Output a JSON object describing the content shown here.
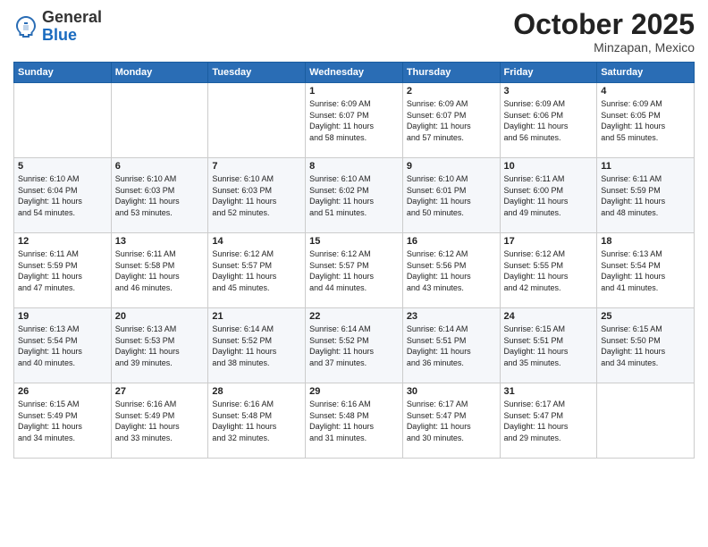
{
  "header": {
    "logo_general": "General",
    "logo_blue": "Blue",
    "month": "October 2025",
    "location": "Minzapan, Mexico"
  },
  "weekdays": [
    "Sunday",
    "Monday",
    "Tuesday",
    "Wednesday",
    "Thursday",
    "Friday",
    "Saturday"
  ],
  "weeks": [
    [
      {
        "day": "",
        "info": ""
      },
      {
        "day": "",
        "info": ""
      },
      {
        "day": "",
        "info": ""
      },
      {
        "day": "1",
        "info": "Sunrise: 6:09 AM\nSunset: 6:07 PM\nDaylight: 11 hours\nand 58 minutes."
      },
      {
        "day": "2",
        "info": "Sunrise: 6:09 AM\nSunset: 6:07 PM\nDaylight: 11 hours\nand 57 minutes."
      },
      {
        "day": "3",
        "info": "Sunrise: 6:09 AM\nSunset: 6:06 PM\nDaylight: 11 hours\nand 56 minutes."
      },
      {
        "day": "4",
        "info": "Sunrise: 6:09 AM\nSunset: 6:05 PM\nDaylight: 11 hours\nand 55 minutes."
      }
    ],
    [
      {
        "day": "5",
        "info": "Sunrise: 6:10 AM\nSunset: 6:04 PM\nDaylight: 11 hours\nand 54 minutes."
      },
      {
        "day": "6",
        "info": "Sunrise: 6:10 AM\nSunset: 6:03 PM\nDaylight: 11 hours\nand 53 minutes."
      },
      {
        "day": "7",
        "info": "Sunrise: 6:10 AM\nSunset: 6:03 PM\nDaylight: 11 hours\nand 52 minutes."
      },
      {
        "day": "8",
        "info": "Sunrise: 6:10 AM\nSunset: 6:02 PM\nDaylight: 11 hours\nand 51 minutes."
      },
      {
        "day": "9",
        "info": "Sunrise: 6:10 AM\nSunset: 6:01 PM\nDaylight: 11 hours\nand 50 minutes."
      },
      {
        "day": "10",
        "info": "Sunrise: 6:11 AM\nSunset: 6:00 PM\nDaylight: 11 hours\nand 49 minutes."
      },
      {
        "day": "11",
        "info": "Sunrise: 6:11 AM\nSunset: 5:59 PM\nDaylight: 11 hours\nand 48 minutes."
      }
    ],
    [
      {
        "day": "12",
        "info": "Sunrise: 6:11 AM\nSunset: 5:59 PM\nDaylight: 11 hours\nand 47 minutes."
      },
      {
        "day": "13",
        "info": "Sunrise: 6:11 AM\nSunset: 5:58 PM\nDaylight: 11 hours\nand 46 minutes."
      },
      {
        "day": "14",
        "info": "Sunrise: 6:12 AM\nSunset: 5:57 PM\nDaylight: 11 hours\nand 45 minutes."
      },
      {
        "day": "15",
        "info": "Sunrise: 6:12 AM\nSunset: 5:57 PM\nDaylight: 11 hours\nand 44 minutes."
      },
      {
        "day": "16",
        "info": "Sunrise: 6:12 AM\nSunset: 5:56 PM\nDaylight: 11 hours\nand 43 minutes."
      },
      {
        "day": "17",
        "info": "Sunrise: 6:12 AM\nSunset: 5:55 PM\nDaylight: 11 hours\nand 42 minutes."
      },
      {
        "day": "18",
        "info": "Sunrise: 6:13 AM\nSunset: 5:54 PM\nDaylight: 11 hours\nand 41 minutes."
      }
    ],
    [
      {
        "day": "19",
        "info": "Sunrise: 6:13 AM\nSunset: 5:54 PM\nDaylight: 11 hours\nand 40 minutes."
      },
      {
        "day": "20",
        "info": "Sunrise: 6:13 AM\nSunset: 5:53 PM\nDaylight: 11 hours\nand 39 minutes."
      },
      {
        "day": "21",
        "info": "Sunrise: 6:14 AM\nSunset: 5:52 PM\nDaylight: 11 hours\nand 38 minutes."
      },
      {
        "day": "22",
        "info": "Sunrise: 6:14 AM\nSunset: 5:52 PM\nDaylight: 11 hours\nand 37 minutes."
      },
      {
        "day": "23",
        "info": "Sunrise: 6:14 AM\nSunset: 5:51 PM\nDaylight: 11 hours\nand 36 minutes."
      },
      {
        "day": "24",
        "info": "Sunrise: 6:15 AM\nSunset: 5:51 PM\nDaylight: 11 hours\nand 35 minutes."
      },
      {
        "day": "25",
        "info": "Sunrise: 6:15 AM\nSunset: 5:50 PM\nDaylight: 11 hours\nand 34 minutes."
      }
    ],
    [
      {
        "day": "26",
        "info": "Sunrise: 6:15 AM\nSunset: 5:49 PM\nDaylight: 11 hours\nand 34 minutes."
      },
      {
        "day": "27",
        "info": "Sunrise: 6:16 AM\nSunset: 5:49 PM\nDaylight: 11 hours\nand 33 minutes."
      },
      {
        "day": "28",
        "info": "Sunrise: 6:16 AM\nSunset: 5:48 PM\nDaylight: 11 hours\nand 32 minutes."
      },
      {
        "day": "29",
        "info": "Sunrise: 6:16 AM\nSunset: 5:48 PM\nDaylight: 11 hours\nand 31 minutes."
      },
      {
        "day": "30",
        "info": "Sunrise: 6:17 AM\nSunset: 5:47 PM\nDaylight: 11 hours\nand 30 minutes."
      },
      {
        "day": "31",
        "info": "Sunrise: 6:17 AM\nSunset: 5:47 PM\nDaylight: 11 hours\nand 29 minutes."
      },
      {
        "day": "",
        "info": ""
      }
    ]
  ]
}
